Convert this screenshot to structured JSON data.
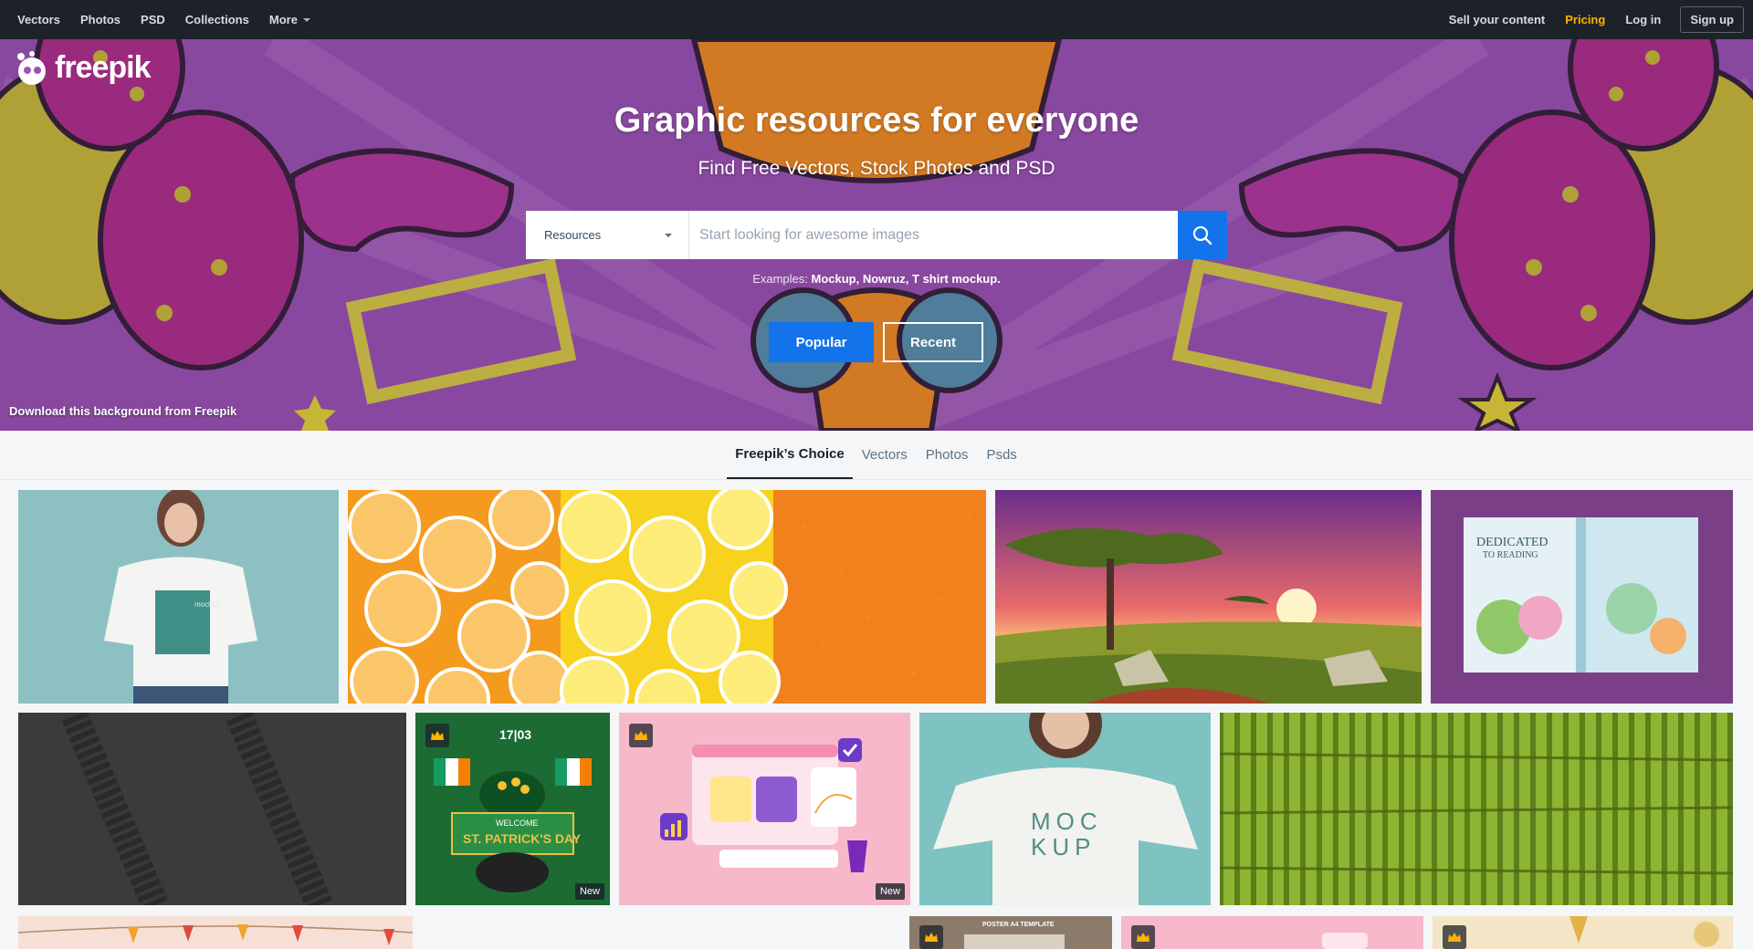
{
  "nav": {
    "left": [
      "Vectors",
      "Photos",
      "PSD",
      "Collections",
      "More"
    ],
    "right": {
      "sell": "Sell your content",
      "pricing": "Pricing",
      "login": "Log in",
      "signup": "Sign up"
    }
  },
  "brand": {
    "name": "freepik",
    "logo_icon": "freepik-logo-icon"
  },
  "hero": {
    "title": "Graphic resources for everyone",
    "subtitle": "Find Free Vectors, Stock Photos and PSD",
    "search": {
      "type": "Resources",
      "placeholder": "Start looking for awesome images",
      "icon": "search-icon"
    },
    "examples_label": "Examples:",
    "examples": "Mockup, Nowruz, T shirt mockup.",
    "buttons": {
      "popular": "Popular",
      "recent": "Recent"
    },
    "credit": "Download this background from Freepik"
  },
  "tabs": [
    {
      "label": "Freepik’s Choice",
      "active": true
    },
    {
      "label": "Vectors",
      "active": false
    },
    {
      "label": "Photos",
      "active": false
    },
    {
      "label": "Psds",
      "active": false
    }
  ],
  "tiles": {
    "tshirt_text": "mockup",
    "book_title": "DEDICATED",
    "book_subtitle": "TO READING",
    "patrick_date": "17|03",
    "patrick_title": "ST. PATRICK'S DAY",
    "patrick_welcome": "WELCOME",
    "mockup_word1": "MOC",
    "mockup_word2": "KUP",
    "poster_text": "POSTER A4 TEMPLATE",
    "new_badge": "New"
  },
  "colors": {
    "nav_bg": "#1c2228",
    "accent": "#1273eb",
    "pricing": "#ffb300",
    "hero_purple": "#9b4fb4"
  }
}
